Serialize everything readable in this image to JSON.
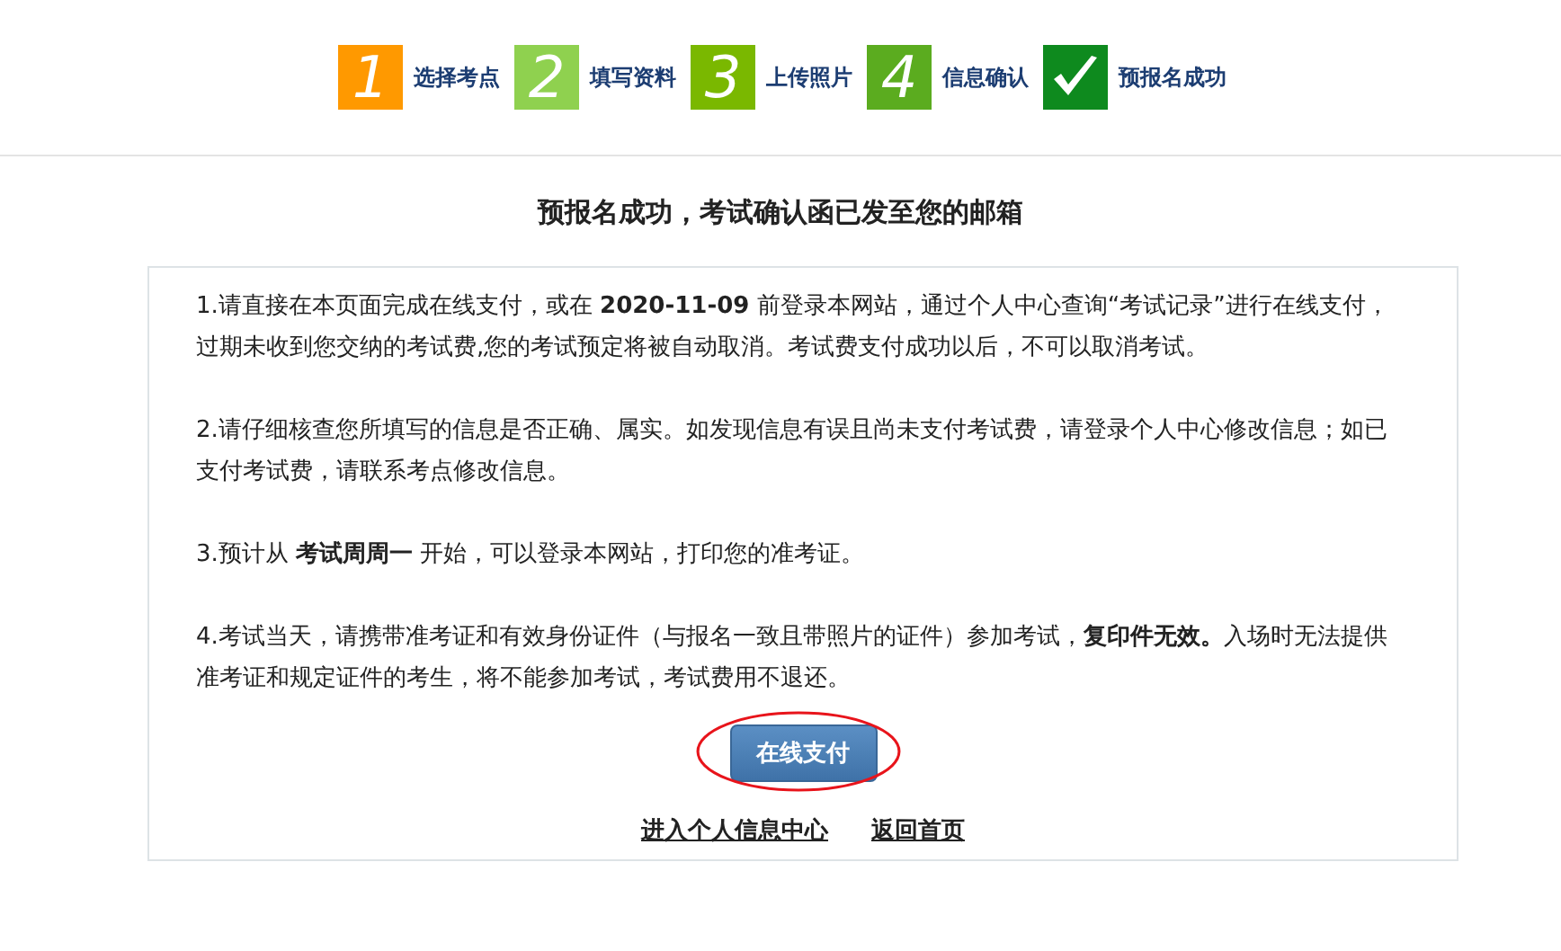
{
  "steps": [
    {
      "kind": "number",
      "mark": "1",
      "color": "#ff9900",
      "label": "选择考点"
    },
    {
      "kind": "number",
      "mark": "2",
      "color": "#8fd14f",
      "label": "填写资料"
    },
    {
      "kind": "number",
      "mark": "3",
      "color": "#7ab800",
      "label": "上传照片"
    },
    {
      "kind": "number",
      "mark": "4",
      "color": "#5bac1f",
      "label": "信息确认"
    },
    {
      "kind": "check",
      "color": "#0e8a1e",
      "label": "预报名成功"
    }
  ],
  "title": "预报名成功，考试确认函已发至您的邮箱",
  "notes": [
    "1.请直接在本页面完成在线支付，或在 **2020-11-09** 前登录本网站，通过个人中心查询“考试记录”进行在线支付，过期未收到您交纳的考试费,您的考试预定将被自动取消。考试费支付成功以后，不可以取消考试。",
    "2.请仔细核查您所填写的信息是否正确、属实。如发现信息有误且尚未支付考试费，请登录个人中心修改信息；如已支付考试费，请联系考点修改信息。",
    "3.预计从 **考试周周一** 开始，可以登录本网站，打印您的准考证。",
    "4.考试当天，请携带准考证和有效身份证件（与报名一致且带照片的证件）参加考试，**复印件无效。**入场时无法提供准考证和规定证件的考生，将不能参加考试，考试费用不退还。"
  ],
  "pay_button": "在线支付",
  "links": [
    "进入个人信息中心",
    "返回首页"
  ]
}
